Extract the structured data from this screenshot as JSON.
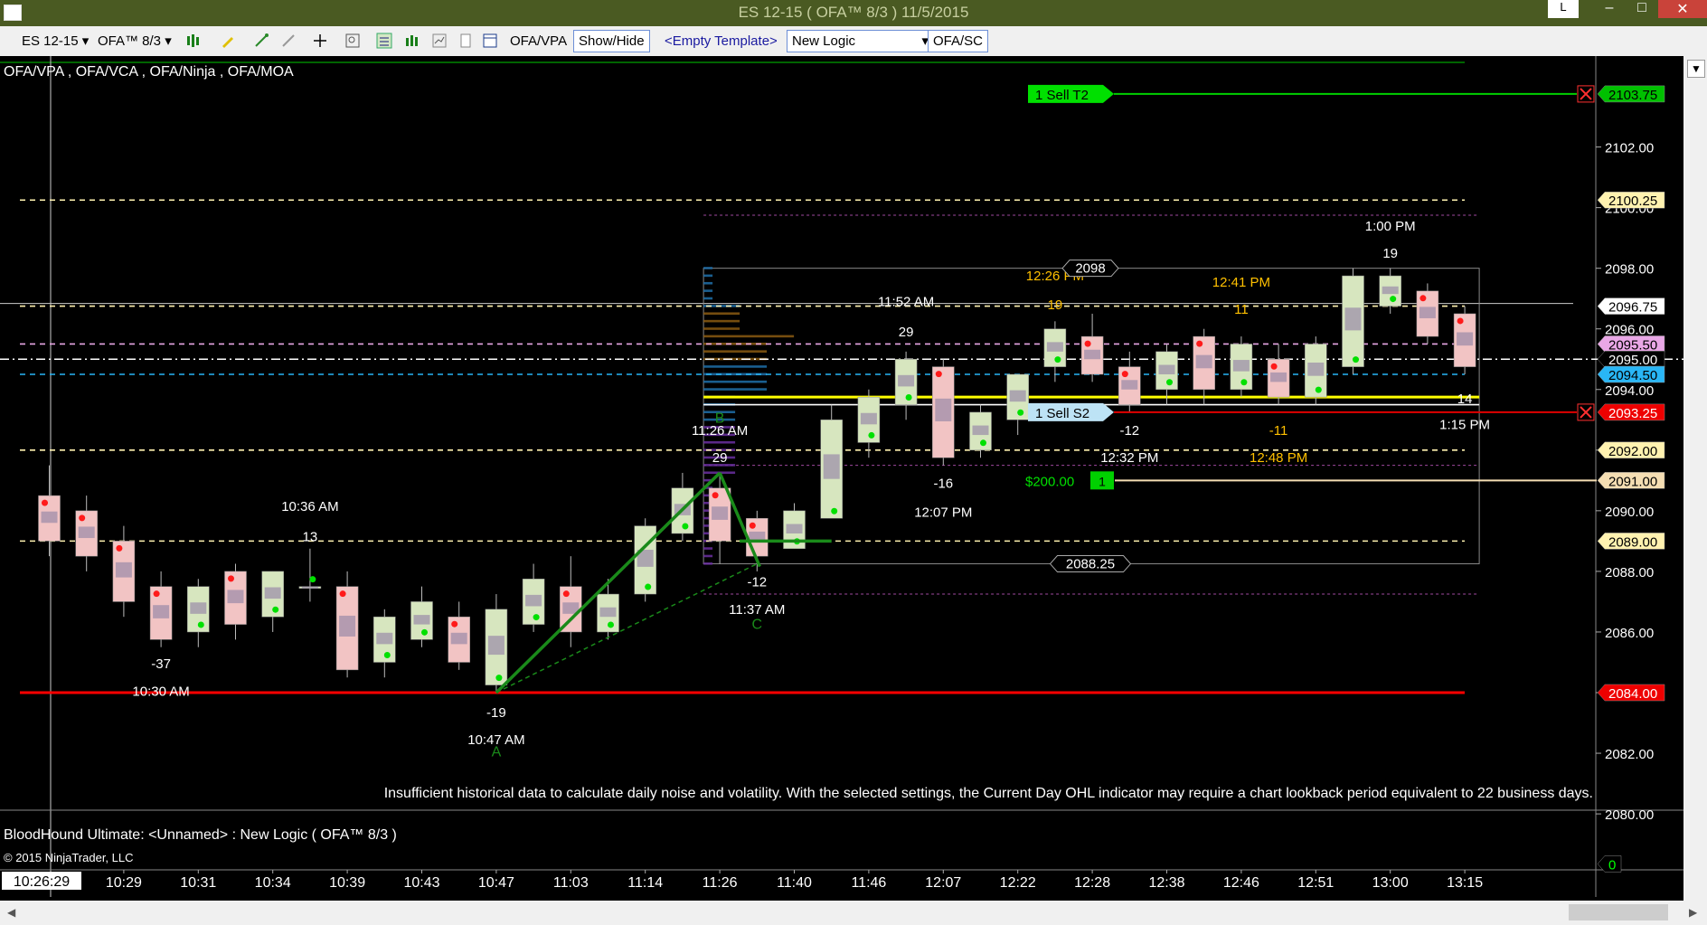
{
  "window": {
    "title": "ES 12-15 ( OFA™ 8/3 )  11/5/2015",
    "min_label": "L"
  },
  "toolbar": {
    "instrument": "ES 12-15",
    "period": "OFA™ 8/3",
    "ofa_vpa": "OFA/VPA",
    "show_hide": "Show/Hide",
    "template": "<Empty Template>",
    "logic": "New Logic",
    "ofa_sc": "OFA/SC"
  },
  "colors": {
    "bull": "#d7e6bf",
    "bear": "#f2c4c4",
    "grid": "#8a8a8a",
    "red_line": "#ff0000",
    "green_line": "#00c800",
    "yellow_line": "#ffff00"
  },
  "chart_data": {
    "type": "candlestick",
    "indicator_label": "OFA/VPA , OFA/VCA , OFA/Ninja , OFA/MOA",
    "notice": "Insufficient historical data to calculate daily noise and volatility. With the selected settings, the Current Day OHL indicator may require a chart lookback period equivalent to 22 business days.",
    "strategy_label": "BloodHound Ultimate: <Unnamed> : New Logic ( OFA™ 8/3 )",
    "copyright": "© 2015 NinjaTrader, LLC",
    "ylim": [
      2078.75,
      2105.0
    ],
    "y_ticks": [
      "2080.00",
      "2082.00",
      "2084.00",
      "2086.00",
      "2088.00",
      "2090.00",
      "2092.00",
      "2094.00",
      "2096.00",
      "2098.00",
      "2100.00",
      "2102.00"
    ],
    "x_ticks": [
      "10:29",
      "10:31",
      "10:34",
      "10:39",
      "10:43",
      "10:47",
      "11:03",
      "11:14",
      "11:26",
      "11:40",
      "11:46",
      "12:07",
      "12:22",
      "12:28",
      "12:38",
      "12:46",
      "12:51",
      "13:00",
      "13:15"
    ],
    "cursor_time": "10:26:29",
    "candles": [
      {
        "o": 2090.5,
        "h": 2091.5,
        "l": 2088.5,
        "c": 2089.0
      },
      {
        "o": 2090.0,
        "h": 2090.5,
        "l": 2088.0,
        "c": 2088.5
      },
      {
        "o": 2089.0,
        "h": 2089.5,
        "l": 2086.5,
        "c": 2087.0
      },
      {
        "o": 2087.5,
        "h": 2088.0,
        "l": 2085.5,
        "c": 2085.75
      },
      {
        "o": 2086.0,
        "h": 2087.75,
        "l": 2085.5,
        "c": 2087.5
      },
      {
        "o": 2088.0,
        "h": 2088.25,
        "l": 2085.75,
        "c": 2086.25
      },
      {
        "o": 2086.5,
        "h": 2088.0,
        "l": 2086.0,
        "c": 2088.0
      },
      {
        "o": 2087.5,
        "h": 2088.75,
        "l": 2087.0,
        "c": 2087.5
      },
      {
        "o": 2087.5,
        "h": 2088.0,
        "l": 2084.5,
        "c": 2084.75
      },
      {
        "o": 2085.0,
        "h": 2086.75,
        "l": 2084.5,
        "c": 2086.5
      },
      {
        "o": 2085.75,
        "h": 2087.5,
        "l": 2085.5,
        "c": 2087.0
      },
      {
        "o": 2086.5,
        "h": 2087.0,
        "l": 2084.75,
        "c": 2085.0
      },
      {
        "o": 2084.25,
        "h": 2087.25,
        "l": 2084.0,
        "c": 2086.75
      },
      {
        "o": 2086.25,
        "h": 2088.25,
        "l": 2086.0,
        "c": 2087.75
      },
      {
        "o": 2087.5,
        "h": 2088.5,
        "l": 2085.5,
        "c": 2086.0
      },
      {
        "o": 2086.0,
        "h": 2087.75,
        "l": 2085.75,
        "c": 2087.25
      },
      {
        "o": 2087.25,
        "h": 2089.75,
        "l": 2087.0,
        "c": 2089.5
      },
      {
        "o": 2089.25,
        "h": 2091.25,
        "l": 2089.0,
        "c": 2090.75
      },
      {
        "o": 2090.75,
        "h": 2091.25,
        "l": 2088.25,
        "c": 2089.0
      },
      {
        "o": 2089.75,
        "h": 2090.0,
        "l": 2088.0,
        "c": 2088.5
      },
      {
        "o": 2088.75,
        "h": 2090.25,
        "l": 2088.75,
        "c": 2090.0
      },
      {
        "o": 2089.75,
        "h": 2093.5,
        "l": 2089.75,
        "c": 2093.0
      },
      {
        "o": 2092.25,
        "h": 2094.0,
        "l": 2091.75,
        "c": 2093.75
      },
      {
        "o": 2093.5,
        "h": 2095.25,
        "l": 2093.0,
        "c": 2095.0
      },
      {
        "o": 2094.75,
        "h": 2095.0,
        "l": 2091.5,
        "c": 2091.75
      },
      {
        "o": 2092.0,
        "h": 2093.5,
        "l": 2091.75,
        "c": 2093.25
      },
      {
        "o": 2093.0,
        "h": 2094.5,
        "l": 2092.5,
        "c": 2094.5
      },
      {
        "o": 2094.75,
        "h": 2096.25,
        "l": 2094.25,
        "c": 2096.0
      },
      {
        "o": 2095.75,
        "h": 2096.5,
        "l": 2094.25,
        "c": 2094.5
      },
      {
        "o": 2094.75,
        "h": 2095.25,
        "l": 2093.25,
        "c": 2093.5
      },
      {
        "o": 2094.0,
        "h": 2095.5,
        "l": 2093.5,
        "c": 2095.25
      },
      {
        "o": 2095.75,
        "h": 2096.0,
        "l": 2093.5,
        "c": 2094.0
      },
      {
        "o": 2094.0,
        "h": 2095.75,
        "l": 2093.75,
        "c": 2095.5
      },
      {
        "o": 2095.0,
        "h": 2095.5,
        "l": 2093.5,
        "c": 2093.75
      },
      {
        "o": 2093.75,
        "h": 2095.75,
        "l": 2093.5,
        "c": 2095.5
      },
      {
        "o": 2094.75,
        "h": 2098.0,
        "l": 2094.5,
        "c": 2097.75
      },
      {
        "o": 2096.75,
        "h": 2098.0,
        "l": 2096.5,
        "c": 2097.75
      },
      {
        "o": 2097.25,
        "h": 2097.5,
        "l": 2095.5,
        "c": 2095.75
      },
      {
        "o": 2096.5,
        "h": 2096.75,
        "l": 2094.5,
        "c": 2094.75
      }
    ],
    "price_labels": [
      {
        "text": "2103.75",
        "value": 2103.75,
        "bg": "#00c000",
        "fg": "#000000"
      },
      {
        "text": "2100.25",
        "value": 2100.25,
        "bg": "#fff2b0",
        "fg": "#000000"
      },
      {
        "text": "2096.75",
        "value": 2096.75,
        "bg": "#ffffff",
        "fg": "#000000"
      },
      {
        "text": "2095.50",
        "value": 2095.5,
        "bg": "#e9a7e6",
        "fg": "#000000"
      },
      {
        "text": "2095.00",
        "value": 2095.0,
        "bg": "#000000",
        "fg": "#ffffff"
      },
      {
        "text": "2094.50",
        "value": 2094.5,
        "bg": "#29b6f6",
        "fg": "#000000"
      },
      {
        "text": "2093.25",
        "value": 2093.25,
        "bg": "#ee0000",
        "fg": "#ffffff"
      },
      {
        "text": "2092.00",
        "value": 2092.0,
        "bg": "#fff2b0",
        "fg": "#000000"
      },
      {
        "text": "2091.00",
        "value": 2091.0,
        "bg": "#f5deb3",
        "fg": "#000000"
      },
      {
        "text": "2089.00",
        "value": 2089.0,
        "bg": "#fff2b0",
        "fg": "#000000"
      },
      {
        "text": "2084.00",
        "value": 2084.0,
        "bg": "#ee0000",
        "fg": "#ffffff"
      },
      {
        "text": "0",
        "value": 2078.35,
        "bg": "#000000",
        "fg": "#00ff00"
      }
    ],
    "annotations": [
      {
        "text": "10:30 AM",
        "bar": 3,
        "value": 2083.9,
        "color": "#ffffff"
      },
      {
        "text": "-37",
        "bar": 3,
        "value": 2084.8,
        "color": "#ffffff"
      },
      {
        "text": "10:36 AM",
        "bar": 7,
        "value": 2090.0,
        "color": "#ffffff"
      },
      {
        "text": "13",
        "bar": 7,
        "value": 2089.0,
        "color": "#ffffff"
      },
      {
        "text": "-19",
        "bar": 12,
        "value": 2083.2,
        "color": "#ffffff"
      },
      {
        "text": "10:47 AM",
        "bar": 12,
        "value": 2082.3,
        "color": "#ffffff"
      },
      {
        "text": "11:26 AM",
        "bar": 18,
        "value": 2092.5,
        "color": "#ffffff"
      },
      {
        "text": "29",
        "bar": 18,
        "value": 2091.6,
        "color": "#ffffff"
      },
      {
        "text": "-12",
        "bar": 19,
        "value": 2087.5,
        "color": "#ffffff"
      },
      {
        "text": "11:37 AM",
        "bar": 19,
        "value": 2086.6,
        "color": "#ffffff"
      },
      {
        "text": "11:52 AM",
        "bar": 23,
        "value": 2096.75,
        "color": "#ffffff"
      },
      {
        "text": "29",
        "bar": 23,
        "value": 2095.75,
        "color": "#ffffff"
      },
      {
        "text": "-16",
        "bar": 24,
        "value": 2090.75,
        "color": "#ffffff"
      },
      {
        "text": "12:07 PM",
        "bar": 24,
        "value": 2089.8,
        "color": "#ffffff"
      },
      {
        "text": "12:26 PM",
        "bar": 27,
        "value": 2097.6,
        "color": "#ffc000"
      },
      {
        "text": "19",
        "bar": 27,
        "value": 2096.65,
        "color": "#ffc000"
      },
      {
        "text": "-12",
        "bar": 29,
        "value": 2092.5,
        "color": "#ffffff"
      },
      {
        "text": "12:32 PM",
        "bar": 29,
        "value": 2091.6,
        "color": "#ffffff"
      },
      {
        "text": "12:41 PM",
        "bar": 32,
        "value": 2097.4,
        "color": "#ffc000"
      },
      {
        "text": "11",
        "bar": 32,
        "value": 2096.5,
        "color": "#ffc000"
      },
      {
        "text": "-11",
        "bar": 33,
        "value": 2092.5,
        "color": "#ffc000"
      },
      {
        "text": "12:48 PM",
        "bar": 33,
        "value": 2091.6,
        "color": "#ffc000"
      },
      {
        "text": "1:00 PM",
        "bar": 36,
        "value": 2099.25,
        "color": "#ffffff"
      },
      {
        "text": "19",
        "bar": 36,
        "value": 2098.35,
        "color": "#ffffff"
      },
      {
        "text": "14",
        "bar": 38,
        "value": 2093.55,
        "color": "#ffffff"
      },
      {
        "text": "1:15 PM",
        "bar": 38,
        "value": 2092.7,
        "color": "#ffffff"
      }
    ],
    "pattern_labels": [
      {
        "text": "A",
        "bar": 12,
        "value": 2081.9
      },
      {
        "text": "B",
        "bar": 18,
        "value": 2092.9
      },
      {
        "text": "C",
        "bar": 19,
        "value": 2086.1
      }
    ],
    "levels": [
      {
        "value": 2100.25,
        "color": "#fff2b0",
        "dash": "6,5"
      },
      {
        "value": 2096.75,
        "color": "#fff2b0",
        "dash": "6,5"
      },
      {
        "value": 2095.5,
        "color": "#e9a7e6",
        "dash": "6,5"
      },
      {
        "value": 2095.0,
        "color": "#ffffff",
        "dash": "10,4,2,4"
      },
      {
        "value": 2094.5,
        "color": "#29b6f6",
        "dash": "6,5"
      },
      {
        "value": 2093.75,
        "color": "#ffff00",
        "dash": ""
      },
      {
        "value": 2093.5,
        "color": "#ffffff",
        "dash": ""
      },
      {
        "value": 2092.0,
        "color": "#fff2b0",
        "dash": "6,5"
      },
      {
        "value": 2089.0,
        "color": "#fff2b0",
        "dash": "6,5"
      },
      {
        "value": 2084.0,
        "color": "#ff0000",
        "dash": ""
      }
    ],
    "orders": [
      {
        "label": "1  Sell T2",
        "value": 2103.75,
        "type": "target"
      },
      {
        "label": "1  Sell S2",
        "value": 2093.25,
        "type": "stop"
      },
      {
        "label": "$200.00",
        "qty": "1",
        "value": 2091.0,
        "type": "position"
      }
    ],
    "profile_box": {
      "high": 2098.0,
      "low": 2088.25,
      "high_label": "2098",
      "low_label": "2088.25"
    }
  }
}
